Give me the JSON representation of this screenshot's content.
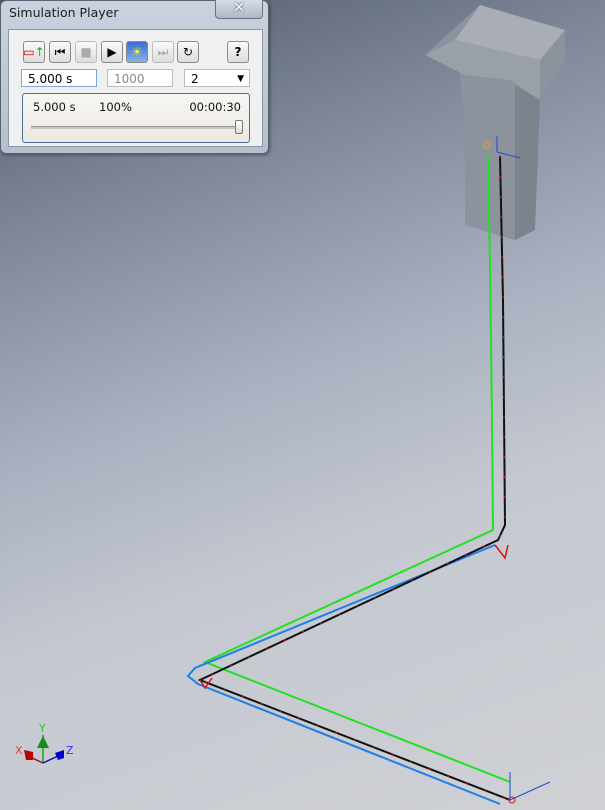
{
  "window": {
    "title": "Simulation Player",
    "close_label": "✕"
  },
  "toolbar": {
    "buttons": [
      {
        "name": "construction-mode",
        "icon": "coordinate-move-icon"
      },
      {
        "name": "rewind",
        "icon": "skip-start-icon"
      },
      {
        "name": "stop",
        "icon": "stop-icon"
      },
      {
        "name": "play",
        "icon": "play-icon"
      },
      {
        "name": "render",
        "icon": "scene-image-icon"
      },
      {
        "name": "end",
        "icon": "skip-end-icon"
      },
      {
        "name": "loop",
        "icon": "loop-icon"
      },
      {
        "name": "help",
        "icon": "help-icon"
      }
    ]
  },
  "fields": {
    "end_time": "5.000 s",
    "images": "1000",
    "filter": "2"
  },
  "status": {
    "current_time": "5.000 s",
    "percent": "100%",
    "elapsed": "00:00:30",
    "progress": 100
  },
  "triad": {
    "x": "X",
    "y": "Y",
    "z": "Z"
  },
  "colors": {
    "green": "#22e022",
    "blue": "#1e7fe6",
    "black": "#111111",
    "red": "#e01010"
  }
}
